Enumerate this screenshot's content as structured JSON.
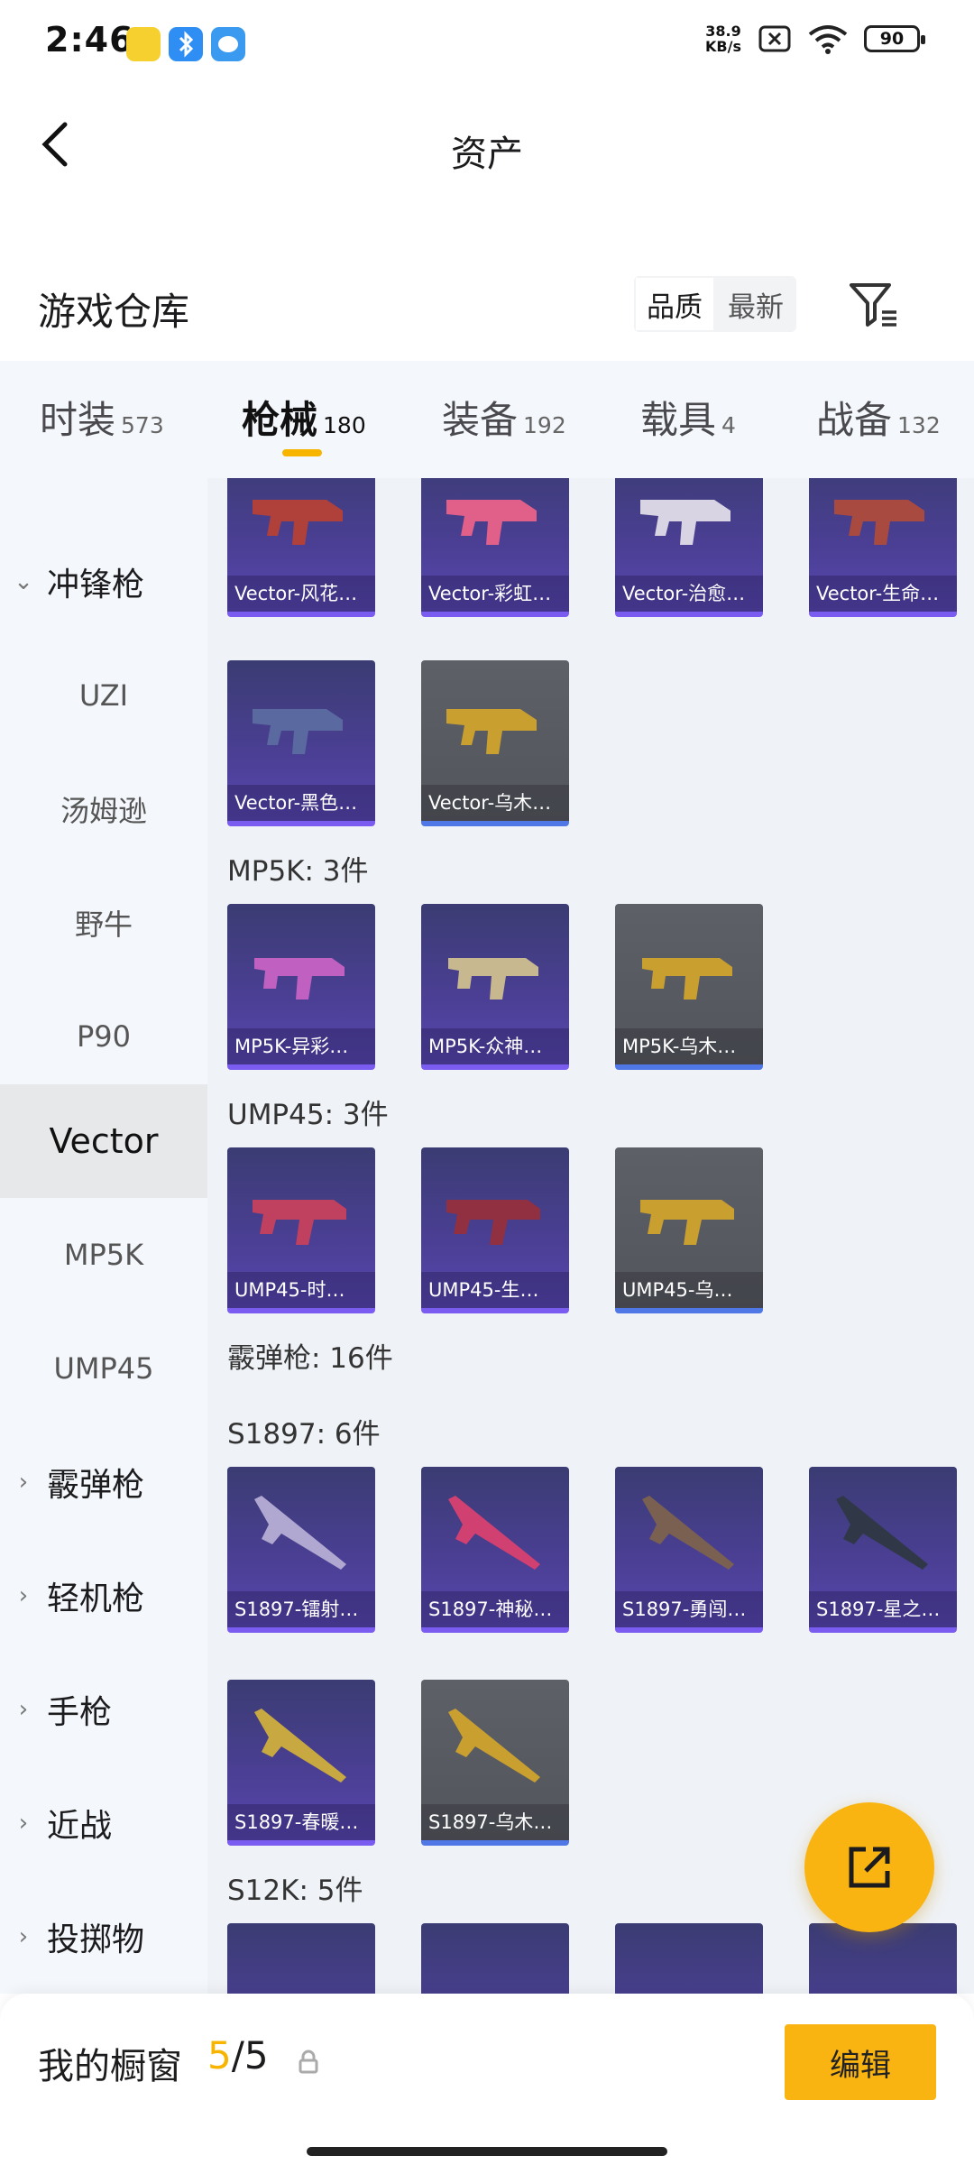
{
  "status": {
    "time": "2:46",
    "net_speed_value": "38.9",
    "net_speed_unit": "KB/s",
    "battery": "90"
  },
  "header": {
    "title": "资产"
  },
  "warehouse": {
    "title": "游戏仓库",
    "sort": [
      "品质",
      "最新"
    ],
    "sort_active": 0
  },
  "tabs": [
    {
      "label": "时装",
      "count": "573"
    },
    {
      "label": "枪械",
      "count": "180",
      "active": true
    },
    {
      "label": "装备",
      "count": "192"
    },
    {
      "label": "载具",
      "count": "4"
    },
    {
      "label": "战备",
      "count": "132"
    }
  ],
  "sidebar": {
    "categories": [
      {
        "label": "冲锋枪",
        "expanded": true
      },
      {
        "label": "霰弹枪"
      },
      {
        "label": "轻机枪"
      },
      {
        "label": "手枪"
      },
      {
        "label": "近战"
      },
      {
        "label": "投掷物"
      }
    ],
    "subs": [
      "UZI",
      "汤姆逊",
      "野牛",
      "P90",
      "Vector",
      "MP5K",
      "UMP45"
    ],
    "active_sub": "Vector"
  },
  "content": {
    "vector_row1": [
      "Vector-风花…",
      "Vector-彩虹…",
      "Vector-治愈…",
      "Vector-生命…"
    ],
    "vector_row2": [
      "Vector-黑色…",
      "Vector-乌木…"
    ],
    "mp5k_header": "MP5K: 3件",
    "mp5k": [
      "MP5K-异彩…",
      "MP5K-众神…",
      "MP5K-乌木…"
    ],
    "ump45_header": "UMP45: 3件",
    "ump45": [
      "UMP45-时…",
      "UMP45-生…",
      "UMP45-乌…"
    ],
    "shotgun_header": "霰弹枪: 16件",
    "s1897_header": "S1897: 6件",
    "s1897_row1": [
      "S1897-镭射…",
      "S1897-神秘…",
      "S1897-勇闯…",
      "S1897-星之…"
    ],
    "s1897_row2": [
      "S1897-春暖…",
      "S1897-乌木…"
    ],
    "s12k_header": "S12K: 5件"
  },
  "showcase": {
    "title": "我的橱窗",
    "current": "5",
    "separator": "/",
    "total": "5",
    "edit_label": "编辑"
  },
  "colors": {
    "accent": "#f7b500",
    "card_purple": "#4b3f95",
    "card_grey": "#5e6068"
  }
}
